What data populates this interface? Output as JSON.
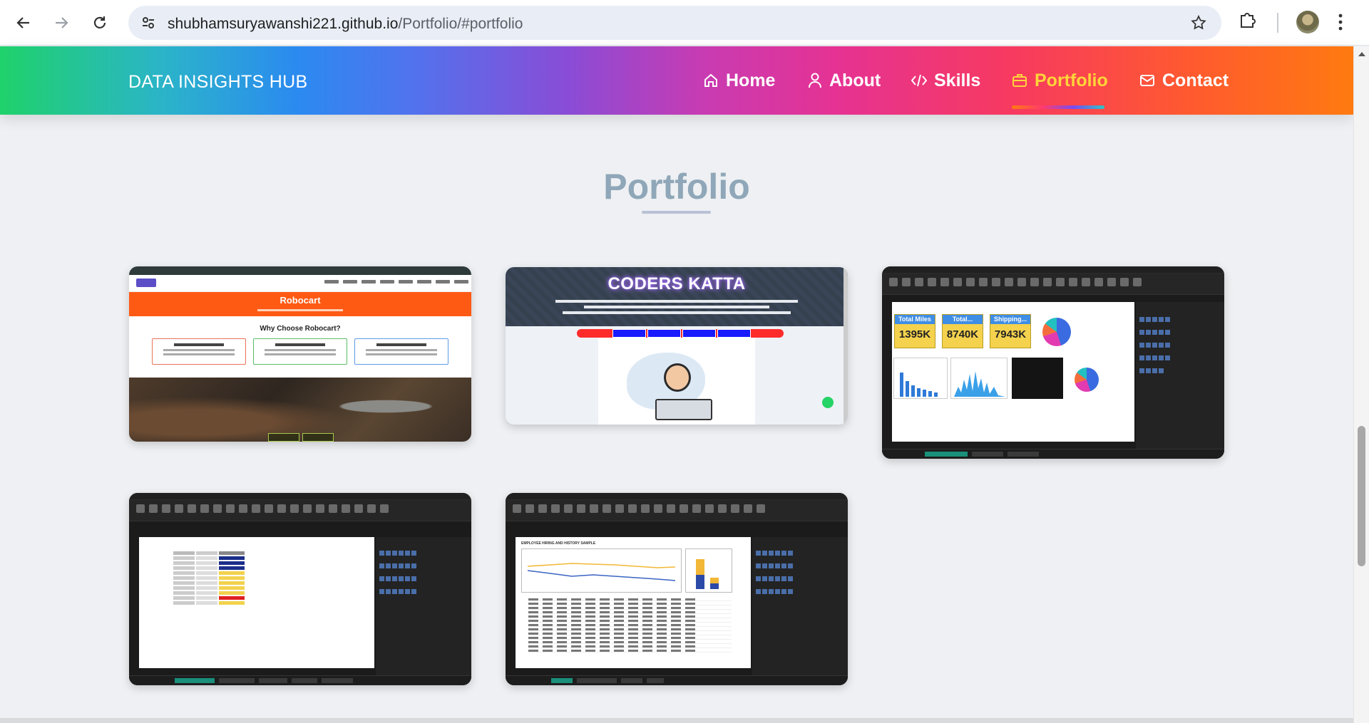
{
  "browser": {
    "url_domain": "shubhamsuryawanshi221.github.io",
    "url_path": "/Portfolio/#portfolio"
  },
  "header": {
    "brand": "DATA INSIGHTS HUB",
    "nav": [
      {
        "label": "Home",
        "icon": "home-icon",
        "active": false
      },
      {
        "label": "About",
        "icon": "user-icon",
        "active": false
      },
      {
        "label": "Skills",
        "icon": "code-icon",
        "active": false
      },
      {
        "label": "Portfolio",
        "icon": "briefcase-icon",
        "active": true
      },
      {
        "label": "Contact",
        "icon": "mail-icon",
        "active": false
      }
    ]
  },
  "section": {
    "title": "Portfolio"
  },
  "projects": [
    {
      "kind": "website-screenshot",
      "title": "Robocart",
      "heading": "Why Choose Robocart?",
      "features": [
        "Wide Range of Products",
        "Quality Assurance",
        "Expert Support"
      ],
      "buttons": [
        "Login",
        "Register"
      ]
    },
    {
      "kind": "website-screenshot",
      "title": "CODERS KATTA",
      "nav": [
        "Home",
        "About us",
        "Contact",
        "Courses"
      ]
    },
    {
      "kind": "powerbi-screenshot",
      "kpis": [
        {
          "label": "Total Miles",
          "value": "1395K"
        },
        {
          "label": "Total...",
          "value": "8740K"
        },
        {
          "label": "Shipping...",
          "value": "7943K"
        }
      ]
    },
    {
      "kind": "powerbi-screenshot"
    },
    {
      "kind": "powerbi-screenshot",
      "report_title": "EMPLOYEE HIRING AND HISTORY SAMPLE"
    }
  ],
  "colors": {
    "active_nav": "#ffd43a",
    "section_title": "#8fa7b8"
  }
}
